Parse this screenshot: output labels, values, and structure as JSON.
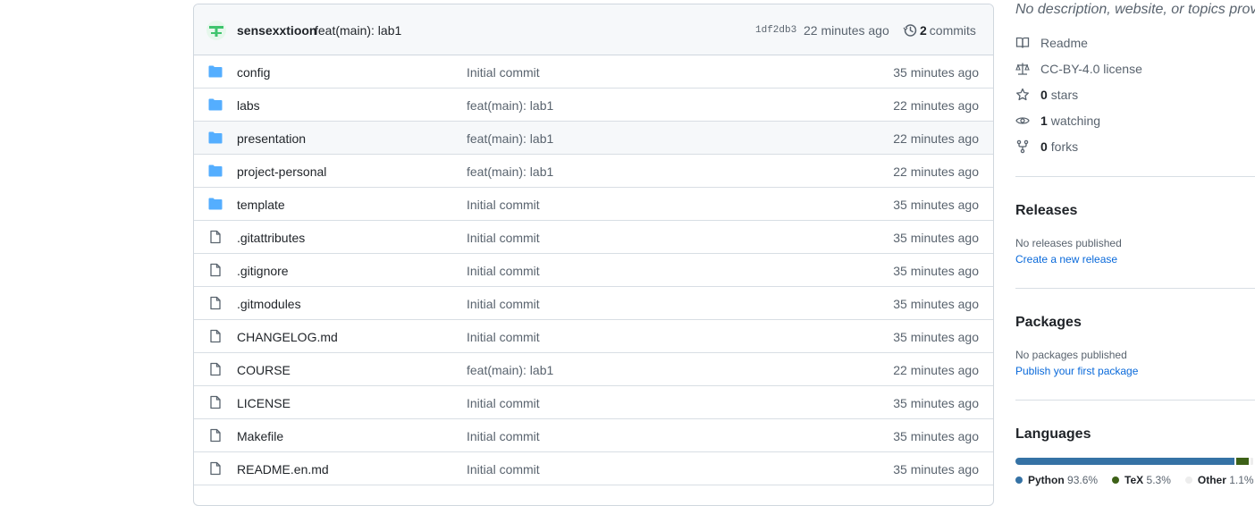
{
  "commit": {
    "author": "sensexxtioon",
    "message": "feat(main): lab1",
    "sha": "1df2db3",
    "time": "22 minutes ago",
    "history_count": "2",
    "history_label": "commits"
  },
  "files": [
    {
      "type": "folder",
      "name": "config",
      "message": "Initial commit",
      "age": "35 minutes ago"
    },
    {
      "type": "folder",
      "name": "labs",
      "message": "feat(main): lab1",
      "age": "22 minutes ago"
    },
    {
      "type": "folder",
      "name": "presentation",
      "message": "feat(main): lab1",
      "age": "22 minutes ago"
    },
    {
      "type": "folder",
      "name": "project-personal",
      "message": "feat(main): lab1",
      "age": "22 minutes ago"
    },
    {
      "type": "folder",
      "name": "template",
      "message": "Initial commit",
      "age": "35 minutes ago"
    },
    {
      "type": "file",
      "name": ".gitattributes",
      "message": "Initial commit",
      "age": "35 minutes ago"
    },
    {
      "type": "file",
      "name": ".gitignore",
      "message": "Initial commit",
      "age": "35 minutes ago"
    },
    {
      "type": "file",
      "name": ".gitmodules",
      "message": "Initial commit",
      "age": "35 minutes ago"
    },
    {
      "type": "file",
      "name": "CHANGELOG.md",
      "message": "Initial commit",
      "age": "35 minutes ago"
    },
    {
      "type": "file",
      "name": "COURSE",
      "message": "feat(main): lab1",
      "age": "22 minutes ago"
    },
    {
      "type": "file",
      "name": "LICENSE",
      "message": "Initial commit",
      "age": "35 minutes ago"
    },
    {
      "type": "file",
      "name": "Makefile",
      "message": "Initial commit",
      "age": "35 minutes ago"
    },
    {
      "type": "file",
      "name": "README.en.md",
      "message": "Initial commit",
      "age": "35 minutes ago"
    }
  ],
  "about": {
    "description": "No description, website, or topics provided.",
    "readme": "Readme",
    "license": "CC-BY-4.0 license",
    "stars_count": "0",
    "stars_label": "stars",
    "watching_count": "1",
    "watching_label": "watching",
    "forks_count": "0",
    "forks_label": "forks"
  },
  "releases": {
    "title": "Releases",
    "text": "No releases published",
    "link": "Create a new release"
  },
  "packages": {
    "title": "Packages",
    "text": "No packages published",
    "link": "Publish your first package"
  },
  "languages": {
    "title": "Languages",
    "items": [
      {
        "name": "Python",
        "percent": "93.6%",
        "share": 0.936,
        "color": "#3572A5"
      },
      {
        "name": "TeX",
        "percent": "5.3%",
        "share": 0.053,
        "color": "#3D6117"
      },
      {
        "name": "Other",
        "percent": "1.1%",
        "share": 0.011,
        "color": "#ededed"
      }
    ]
  },
  "colors": {
    "folder": "#54aeff",
    "file_icon": "#59636e",
    "link": "#0969da"
  }
}
